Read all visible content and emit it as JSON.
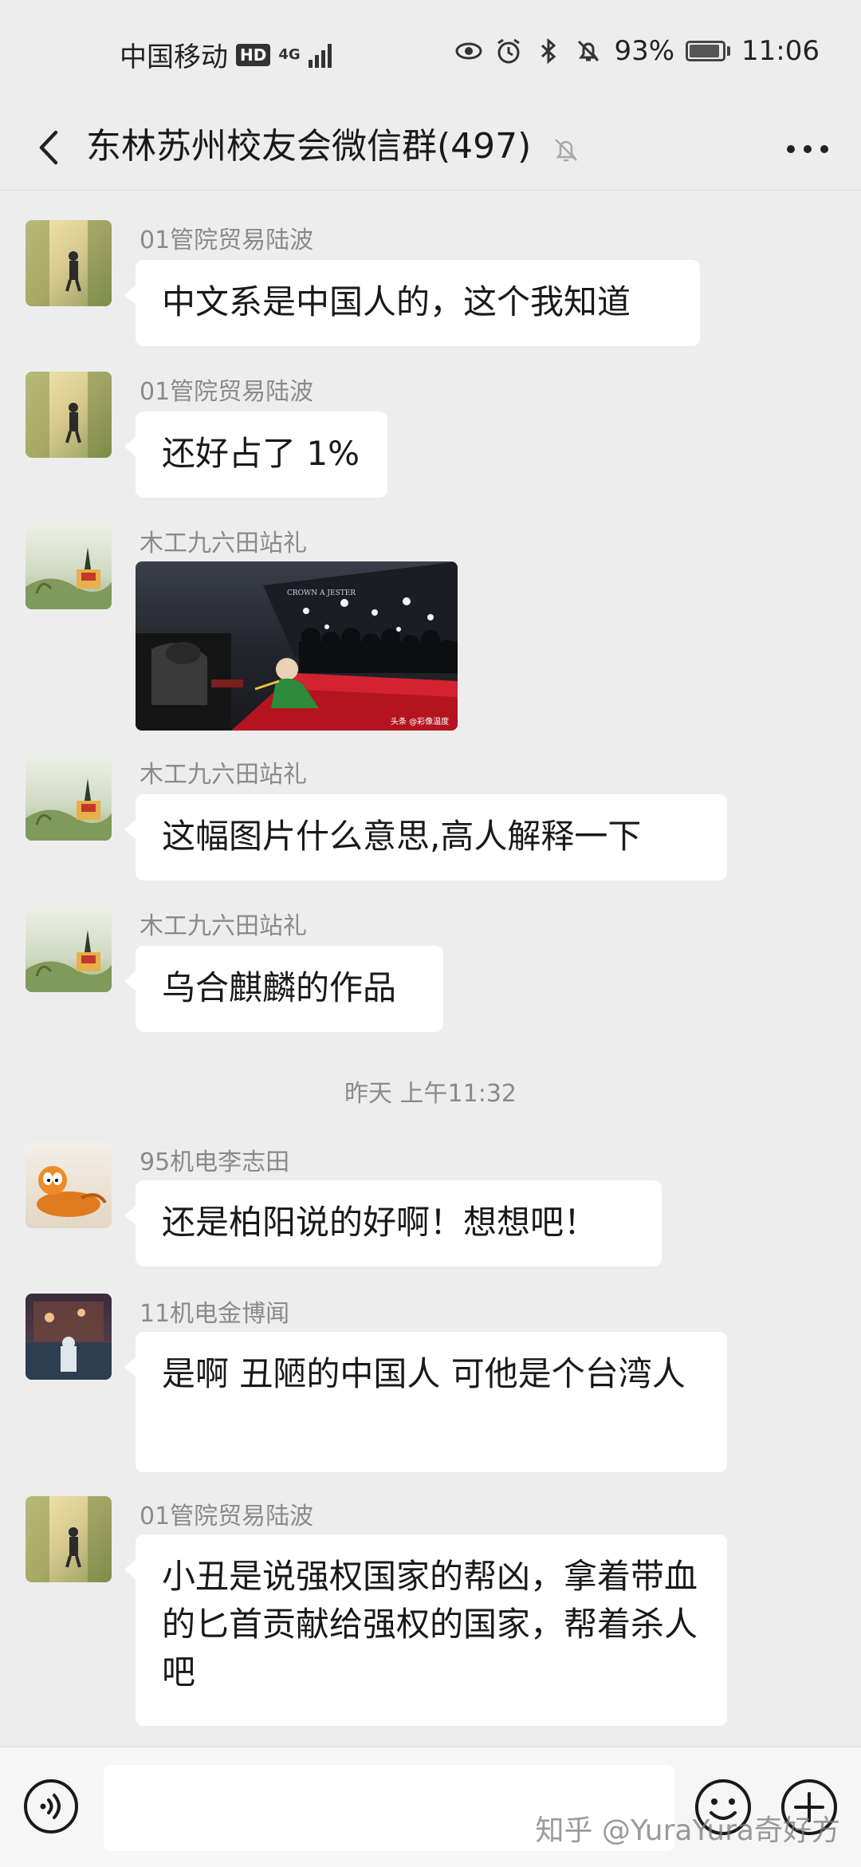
{
  "status_bar": {
    "carrier": "中国移动",
    "hd_badge": "HD",
    "network": "4G",
    "battery_percent": "93%",
    "battery_level": 0.93,
    "time": "11:06"
  },
  "header": {
    "title": "东林苏州校友会微信群(497)"
  },
  "messages": [
    {
      "sender": "01管院贸易陆波",
      "text": "中文系是中国人的，这个我知道"
    },
    {
      "sender": "01管院贸易陆波",
      "text": "还好占了 1%"
    },
    {
      "sender": "木工九六田站礼",
      "image_caption": "CROWN A JESTER",
      "image_credit": "头条 @彩像温度"
    },
    {
      "sender": "木工九六田站礼",
      "text": "这幅图片什么意思,高人解释一下"
    },
    {
      "sender": "木工九六田站礼",
      "text": "乌合麒麟的作品"
    },
    {
      "timestamp": "昨天 上午11:32"
    },
    {
      "sender": "95机电李志田",
      "text": "还是柏阳说的好啊！想想吧！"
    },
    {
      "sender": "11机电金博闻",
      "text": "是啊 丑陋的中国人 可他是个台湾人"
    },
    {
      "sender": "01管院贸易陆波",
      "text": "小丑是说强权国家的帮凶，拿着带血的匕首贡献给强权的国家，帮着杀人吧"
    }
  ],
  "watermark": "知乎 @YuraYura奇好方",
  "icons": [
    "eye-icon",
    "alarm-icon",
    "bluetooth-icon",
    "mute-icon",
    "battery-icon",
    "back-icon",
    "more-icon",
    "voice-icon",
    "emoji-icon",
    "plus-icon"
  ],
  "colors": {
    "background": "#ededed",
    "bubble": "#ffffff",
    "sender": "#8a8a8a"
  }
}
